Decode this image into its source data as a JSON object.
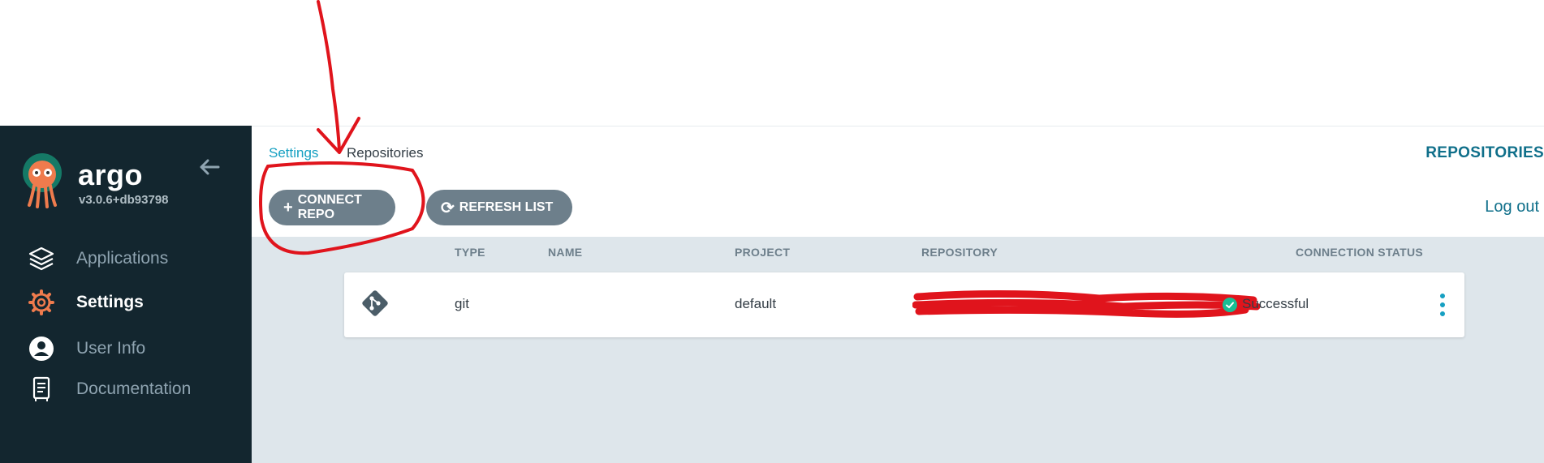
{
  "brand": {
    "name": "argo",
    "version": "v3.0.6+db93798"
  },
  "sidebar": {
    "items": [
      {
        "label": "Applications",
        "icon": "layers-icon"
      },
      {
        "label": "Settings",
        "icon": "gear-icon",
        "active": true
      },
      {
        "label": "User Info",
        "icon": "user-icon"
      },
      {
        "label": "Documentation",
        "icon": "book-icon"
      }
    ]
  },
  "breadcrumb": {
    "settings": "Settings",
    "repositories": "Repositories"
  },
  "page_title": "REPOSITORIES",
  "toolbar": {
    "connect_label": "CONNECT REPO",
    "refresh_label": "REFRESH LIST",
    "logout_label": "Log out"
  },
  "table": {
    "headers": [
      "TYPE",
      "NAME",
      "PROJECT",
      "REPOSITORY",
      "CONNECTION STATUS"
    ],
    "rows": [
      {
        "type": "git",
        "name": "",
        "project": "default",
        "status": "Successful"
      }
    ]
  },
  "colors": {
    "sidebar_bg": "#13262f",
    "accent": "#0f6f8a",
    "button_bg": "#6d7f8b",
    "success": "#18be94",
    "annotation": "#e0141c"
  }
}
